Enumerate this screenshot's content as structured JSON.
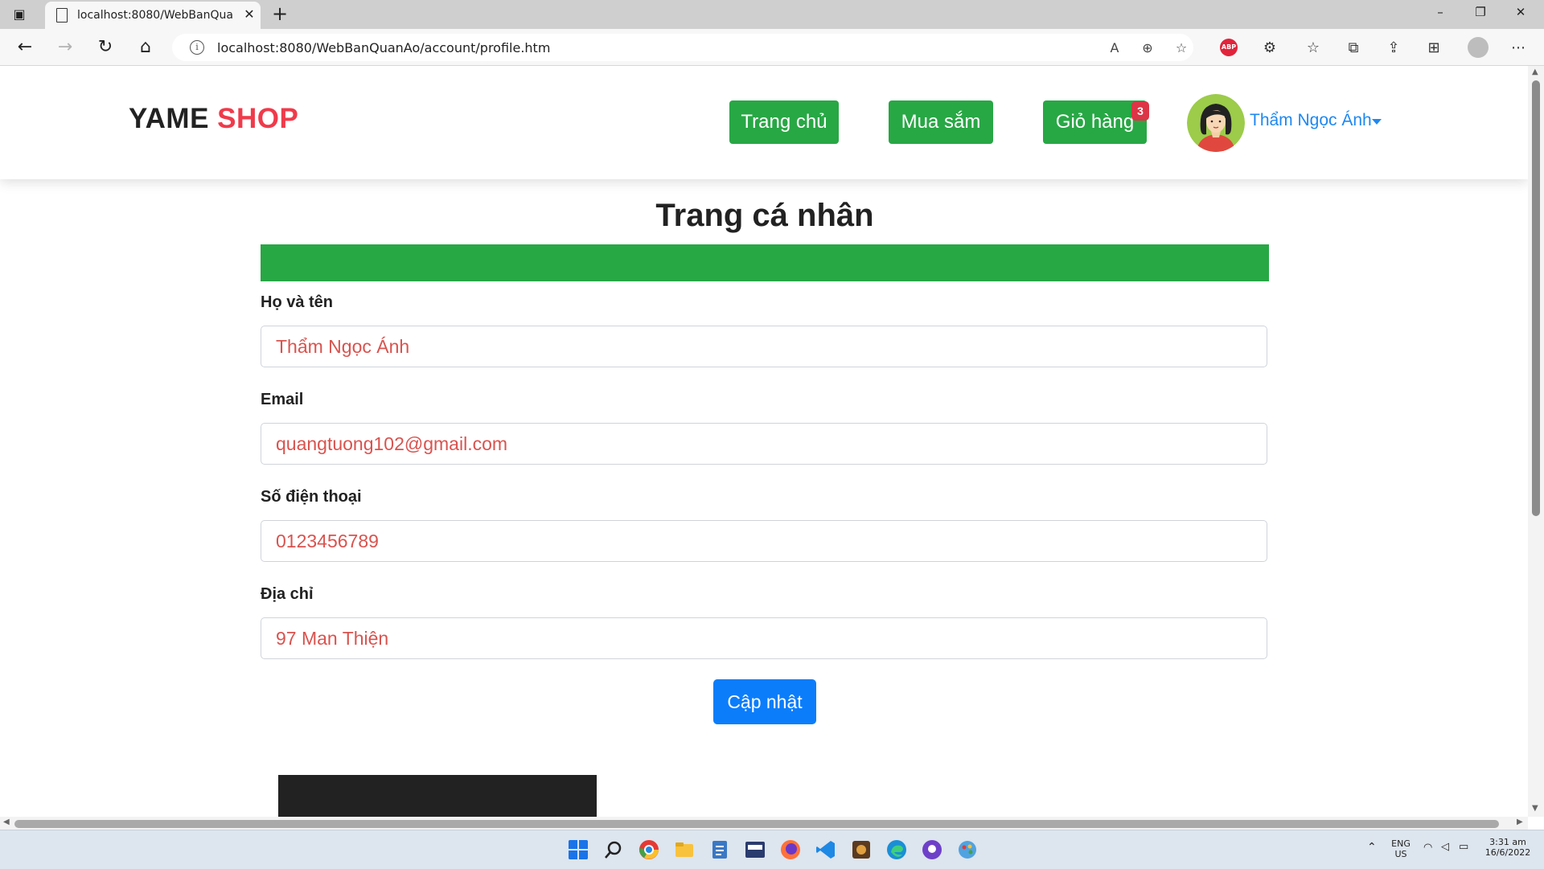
{
  "browser": {
    "tab_title": "localhost:8080/WebBanQuanAo/",
    "url": "localhost:8080/WebBanQuanAo/account/profile.htm",
    "icons": [
      "back-icon",
      "forward-icon",
      "refresh-icon",
      "home-icon",
      "info-icon",
      "read-aloud-icon",
      "zoom-icon",
      "favorite-add-icon",
      "adblock-icon",
      "extensions-icon",
      "favorites-icon",
      "collections-icon",
      "share-icon",
      "sidebar-icon",
      "profile-icon",
      "more-icon"
    ]
  },
  "header": {
    "brand_part1": "YAME",
    "brand_part2": "SHOP",
    "nav": {
      "home": "Trang chủ",
      "shop": "Mua sắm",
      "cart": "Giỏ hàng",
      "cart_count": "3"
    },
    "user_name": "Thẩm Ngọc Ánh"
  },
  "profile": {
    "title": "Trang cá nhân",
    "fields": [
      {
        "label": "Họ và tên",
        "value": "Thẩm Ngọc Ánh"
      },
      {
        "label": "Email",
        "value": "quangtuong102@gmail.com"
      },
      {
        "label": "Số điện thoại",
        "value": "0123456789"
      },
      {
        "label": "Địa chỉ",
        "value": "97 Man Thiện"
      }
    ],
    "update_button": "Cập nhật"
  },
  "colors": {
    "brand_red": "#ef3b4b",
    "green": "#28a745",
    "blue": "#0b7dfb",
    "badge_red": "#dc3545",
    "value_red": "#d9534f",
    "link_blue": "#1e88f0"
  },
  "taskbar": {
    "lang_line1": "ENG",
    "lang_line2": "US",
    "time": "3:31 am",
    "date": "16/6/2022"
  }
}
